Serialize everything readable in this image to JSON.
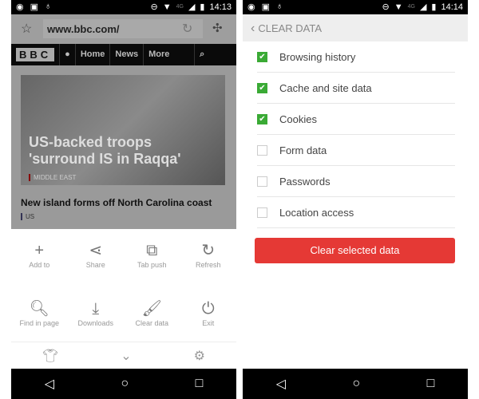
{
  "left": {
    "status": {
      "time": "14:13",
      "network": "4G"
    },
    "url": "www.bbc.com/",
    "bbc_logo": "BBC",
    "nav": [
      "Home",
      "News",
      "More"
    ],
    "hero": {
      "headline": "US-backed troops 'surround IS in Raqqa'",
      "tag": "MIDDLE EAST"
    },
    "story": {
      "headline": "New island forms off North Carolina coast",
      "tag": "US"
    },
    "menu": [
      {
        "label": "Add to",
        "icon": "plus-icon"
      },
      {
        "label": "Share",
        "icon": "share-icon"
      },
      {
        "label": "Tab push",
        "icon": "tab-push-icon"
      },
      {
        "label": "Refresh",
        "icon": "refresh-icon"
      },
      {
        "label": "Find in page",
        "icon": "find-icon"
      },
      {
        "label": "Downloads",
        "icon": "download-icon"
      },
      {
        "label": "Clear data",
        "icon": "brush-icon"
      },
      {
        "label": "Exit",
        "icon": "power-icon"
      }
    ]
  },
  "right": {
    "status": {
      "time": "14:14",
      "network": "4G"
    },
    "title": "CLEAR DATA",
    "items": [
      {
        "label": "Browsing history",
        "checked": true
      },
      {
        "label": "Cache and site data",
        "checked": true
      },
      {
        "label": "Cookies",
        "checked": true
      },
      {
        "label": "Form data",
        "checked": false
      },
      {
        "label": "Passwords",
        "checked": false
      },
      {
        "label": "Location access",
        "checked": false
      }
    ],
    "button": "Clear selected data"
  },
  "colors": {
    "accent": "#e53935",
    "check": "#3aaa35"
  }
}
